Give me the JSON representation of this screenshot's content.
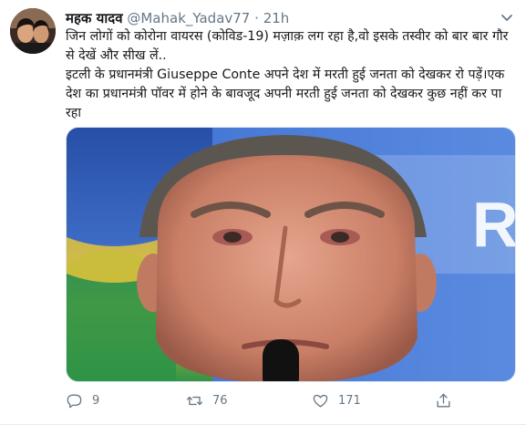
{
  "tweet": {
    "display_name": "महक यादव",
    "handle": "@Mahak_Yadav77",
    "separator": "·",
    "time": "21h",
    "text": "जिन लोगों को कोरोना वायरस (कोविड-19) मज़ाक़ लग रहा है,वो इसके तस्वीर को बार बार गौर से देखें और सीख लें..\nइटली के प्रधानमंत्री Giuseppe Conte अपने देश में मरती हुई जनता को देखकर रो पड़ें।एक देश का प्रधानमंत्री पॉवर में होने के बावजूद अपनी मरती हुई जनता को देखकर कुछ नहीं कर पा रहा"
  },
  "actions": {
    "reply_count": "9",
    "retweet_count": "76",
    "like_count": "171"
  },
  "icons": {
    "more": "chevron-down-icon",
    "reply": "reply-icon",
    "retweet": "retweet-icon",
    "like": "heart-icon",
    "share": "share-icon"
  },
  "colors": {
    "text": "#14171a",
    "secondary": "#657786",
    "photo_background_blue": "#2f5bb8",
    "photo_background_green": "#2e9a4a",
    "photo_background_yellow": "#e9c53a"
  }
}
